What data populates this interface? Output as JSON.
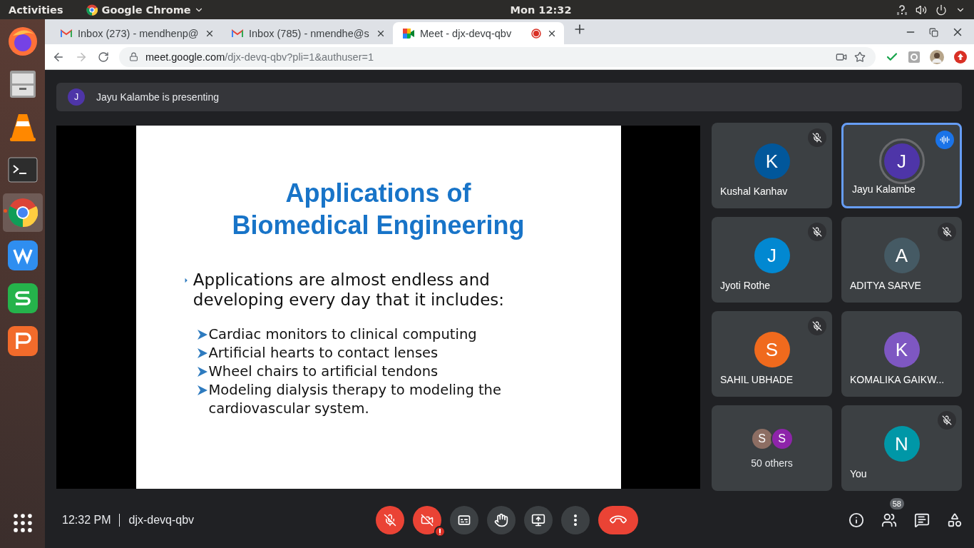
{
  "topbar": {
    "activities": "Activities",
    "app": "Google Chrome",
    "clock": "Mon 12:32"
  },
  "dock": [
    {
      "kind": "firefox",
      "active": false
    },
    {
      "kind": "files",
      "active": false
    },
    {
      "kind": "vlc",
      "active": false
    },
    {
      "kind": "terminal",
      "active": false
    },
    {
      "kind": "chrome",
      "active": true
    },
    {
      "kind": "writer",
      "active": false
    },
    {
      "kind": "sheets",
      "active": false
    },
    {
      "kind": "slides",
      "active": false
    }
  ],
  "tabs": [
    {
      "kind": "gmail",
      "title": "Inbox (273) - mendhenp@",
      "selected": false,
      "recording": false
    },
    {
      "kind": "gmail",
      "title": "Inbox (785) - nmendhe@s",
      "selected": false,
      "recording": false
    },
    {
      "kind": "meet",
      "title": "Meet - djx-devq-qbv",
      "selected": true,
      "recording": true
    }
  ],
  "address": {
    "host": "meet.google.com",
    "path": "/djx-devq-qbv?pli=1&authuser=1"
  },
  "banner": {
    "initial": "J",
    "text": "Jayu Kalambe is presenting"
  },
  "slide": {
    "title": [
      "Applications of",
      "Biomedical Engineering"
    ],
    "bullet": "Applications are almost endless and developing every day that it includes:",
    "items": [
      "Cardiac monitors to clinical computing",
      "Artificial hearts to contact lenses",
      "Wheel chairs to artificial tendons",
      "Modeling dialysis therapy to modeling the cardiovascular system."
    ]
  },
  "participants": [
    {
      "kind": "person",
      "name": "Kushal Kanhav",
      "initial": "K",
      "color": "#01579b",
      "muted": true,
      "speaking": false
    },
    {
      "kind": "person",
      "name": "Jayu Kalambe",
      "initial": "J",
      "color": "#4e35a8",
      "muted": false,
      "speaking": true
    },
    {
      "kind": "person",
      "name": "Jyoti Rothe",
      "initial": "J",
      "color": "#0288d1",
      "muted": true,
      "speaking": false
    },
    {
      "kind": "person",
      "name": "ADITYA SARVE",
      "initial": "A",
      "color": "#455a64",
      "muted": true,
      "speaking": false
    },
    {
      "kind": "person",
      "name": "SAHIL UBHADE",
      "initial": "S",
      "color": "#f06a1d",
      "muted": true,
      "speaking": false
    },
    {
      "kind": "person",
      "name": "KOMALIKA GAIKW...",
      "initial": "K",
      "color": "#7e57c2",
      "muted": false,
      "speaking": false
    },
    {
      "kind": "others",
      "name": "50 others",
      "avatars": [
        {
          "initial": "S",
          "color": "#8d6e63"
        },
        {
          "initial": "S",
          "color": "#8e24aa"
        }
      ]
    },
    {
      "kind": "person",
      "name": "You",
      "initial": "N",
      "color": "#0097a7",
      "muted": true,
      "speaking": false
    }
  ],
  "bottom": {
    "time": "12:32 PM",
    "code": "djx-devq-qbv",
    "people_count": "58",
    "controls": [
      {
        "kind": "mic",
        "off": true
      },
      {
        "kind": "camera",
        "off": true
      },
      {
        "kind": "captions",
        "off": false
      },
      {
        "kind": "hand",
        "off": false
      },
      {
        "kind": "present",
        "off": false
      },
      {
        "kind": "more",
        "off": false
      },
      {
        "kind": "leave"
      }
    ]
  }
}
